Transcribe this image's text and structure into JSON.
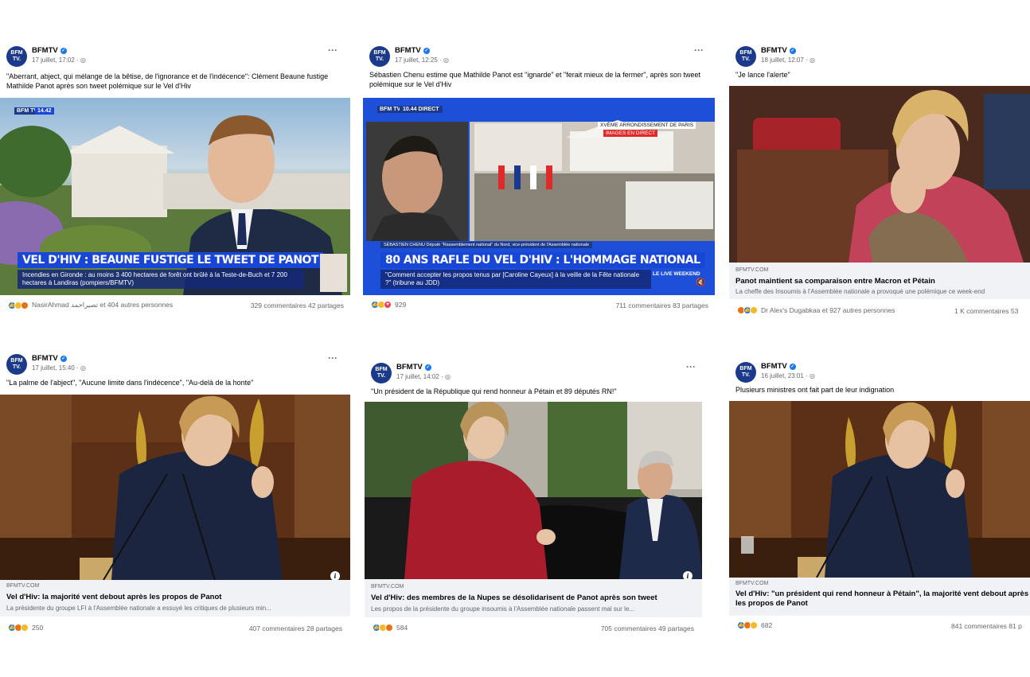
{
  "posts": [
    {
      "page": "BFMTV",
      "date": "17 juillet, 17:02 ·",
      "caption": "\"Aberrant, abject, qui mélange de la bêtise,  de l'ignorance et de l'indécence\": Clément Beaune fustige Mathilde Panot après son tweet polémique sur le Vel d'Hiv",
      "banner": "VEL D'HIV : BEAUNE FUSTIGE LE TWEET DE PANOT",
      "subtitle": "Incendies en Gironde : au moins 3 400 hectares de forêt ont brûlé à la Teste-de-Buch et 7 200 hectares à Landiras (pompiers/BFMTV)",
      "time_tag": "14.42",
      "reactions_text": "NasirAhmad تصیراحمد et 404 autres personnes",
      "stats": "329 commentaires  42 partages"
    },
    {
      "page": "BFMTV",
      "date": "17 juillet, 12:25 ·",
      "caption": "Sébastien Chenu estime que Mathilde Panot est \"ignarde\" et \"ferait mieux de la fermer\", après son tweet polémique sur le Vel d'Hiv",
      "time_tag": "10.44  DIRECT",
      "location_tag": "XVÈME ARRONDISSEMENT DE PARIS",
      "live_tag": "IMAGES EN DIRECT",
      "name_tag": "SÉBASTIEN CHENU  Député \"Rassemblement national\" du Nord, vice-président de l'Assemblée nationale",
      "banner": "80 ANS RAFLE DU VEL D'HIV : L'HOMMAGE NATIONAL",
      "subtitle": "\"Comment accepter les propos tenus par [Caroline Cayeux] à la veille de la Fête nationale ?\" (tribune au JDD)",
      "weekend_tag": "LE LIVE WEEKEND",
      "reactions_text": "929",
      "stats": "711 commentaires  83 partages"
    },
    {
      "page": "BFMTV",
      "date": "18 juillet, 12:07 ·",
      "caption": "\"Je lance l'alerte\"",
      "source": "BFMTV.COM",
      "link_title": "Panot maintient sa comparaison entre Macron et Pétain",
      "link_desc": "La cheffe des Insoumis à l'Assemblée nationale a provoqué une polémique ce week-end",
      "reactions_text": "Dr Alex's Dugabkaa et 927 autres personnes",
      "stats": "1 K commentaires  53"
    },
    {
      "page": "BFMTV",
      "date": "17 juillet, 15:40 ·",
      "caption": "\"La palme de l'abject\", \"Aucune limite dans l'indécence\", \"Au-delà de la honte\"",
      "source": "BFMTV.COM",
      "link_title": "Vel d'Hiv: la majorité vent debout après les propos de Panot",
      "link_desc": "La présidente du groupe LFI à l'Assemblée nationale a essuyé les critiques de plusieurs min...",
      "reactions_text": "250",
      "stats": "407 commentaires  28 partages"
    },
    {
      "page": "BFMTV",
      "date": "17 juillet, 14:02 ·",
      "caption": "\"Un président de la République qui rend honneur à Pétain et 89 députés RN!\"",
      "source": "BFMTV.COM",
      "link_title": "Vel d'Hiv: des membres de la Nupes se désolidarisent de Panot après son tweet",
      "link_desc": "Les propos de la présidente du groupe insoumis à l'Assemblée nationale passent mal sur le...",
      "reactions_text": "584",
      "stats": "705 commentaires  49 partages"
    },
    {
      "page": "BFMTV",
      "date": "16 juillet, 23:01 ·",
      "caption": "Plusieurs ministres ont fait part de leur indignation",
      "source": "BFMTV.COM",
      "link_title": "Vel d'Hiv: \"un président qui rend honneur à Pétain\", la majorité vent debout après les propos de Panot",
      "reactions_text": "682",
      "stats": "841 commentaires  81 p"
    }
  ],
  "logo_text": "BFM TV.",
  "colors": {
    "accent": "#1877f2",
    "bfm_blue": "#1b3a8c",
    "banner_blue": "#1846d6"
  }
}
